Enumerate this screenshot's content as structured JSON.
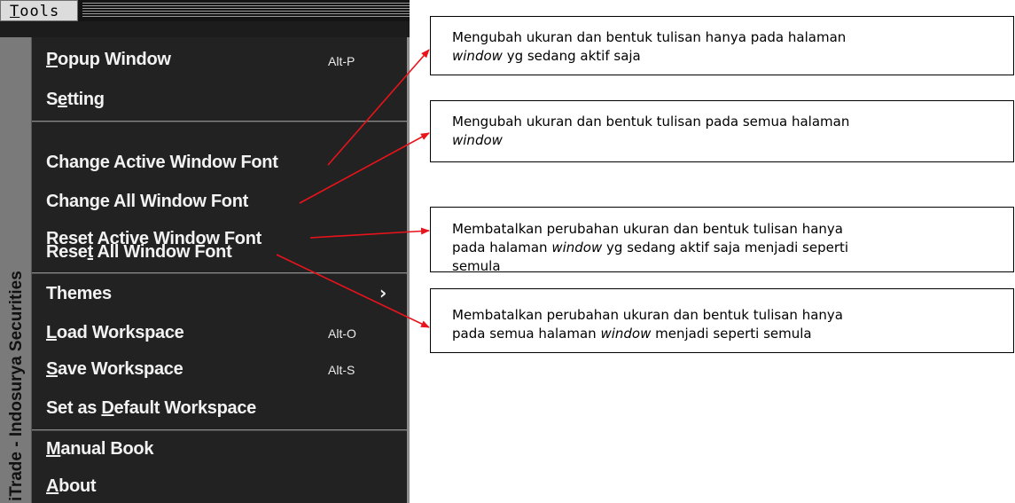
{
  "menubar": {
    "tools_label": "Tools",
    "tools_mnemonic": "T",
    "tools_rest": "ools"
  },
  "side_title": "iTrade - Indosurya  Securities",
  "menu_items": [
    {
      "pre": "",
      "mn": "P",
      "post": "opup Window",
      "shortcut": "Alt-P"
    },
    {
      "pre": "S",
      "mn": "e",
      "post": "tting",
      "shortcut": ""
    },
    {
      "pre": "Change Active Window Font",
      "mn": "",
      "post": "",
      "shortcut": ""
    },
    {
      "pre": "Change All Window Font",
      "mn": "",
      "post": "",
      "shortcut": ""
    },
    {
      "pre": "Reset Active Window Font",
      "mn": "",
      "post": "",
      "shortcut": ""
    },
    {
      "pre": "Rese",
      "mn": "t",
      "post": " All Window Font",
      "shortcut": ""
    },
    {
      "pre": "Themes",
      "mn": "",
      "post": "",
      "shortcut": ""
    },
    {
      "pre": "",
      "mn": "L",
      "post": "oad Workspace",
      "shortcut": "Alt-O"
    },
    {
      "pre": "",
      "mn": "S",
      "post": "ave Workspace",
      "shortcut": "Alt-S"
    },
    {
      "pre": "Set as ",
      "mn": "D",
      "post": "efault Workspace",
      "shortcut": ""
    },
    {
      "pre": "",
      "mn": "M",
      "post": "anual Book",
      "shortcut": ""
    },
    {
      "pre": "",
      "mn": "A",
      "post": "bout",
      "shortcut": ""
    }
  ],
  "submenu_indicator": "›",
  "notes": [
    {
      "l1": "Mengubah ukuran dan bentuk tulisan hanya pada halaman",
      "l2_em": "window",
      "l2_rest": " yg sedang aktif saja",
      "l3": ""
    },
    {
      "l1": "Mengubah ukuran dan bentuk tulisan pada semua halaman",
      "l2_em": "window",
      "l2_rest": "",
      "l3": ""
    },
    {
      "l1": "Membatalkan perubahan ukuran dan bentuk tulisan hanya",
      "l2_pre": "pada halaman ",
      "l2_em": "window",
      "l2_rest": " yg sedang aktif saja menjadi seperti",
      "l3": "semula"
    },
    {
      "l1": "Membatalkan perubahan ukuran dan bentuk tulisan hanya",
      "l2_pre": "pada semua halaman ",
      "l2_em": "window",
      "l2_rest": " menjadi seperti semula",
      "l3": ""
    }
  ],
  "colors": {
    "arrow": "#e8131b",
    "menu_bg": "#222222",
    "menu_text": "#f2f2f2"
  }
}
